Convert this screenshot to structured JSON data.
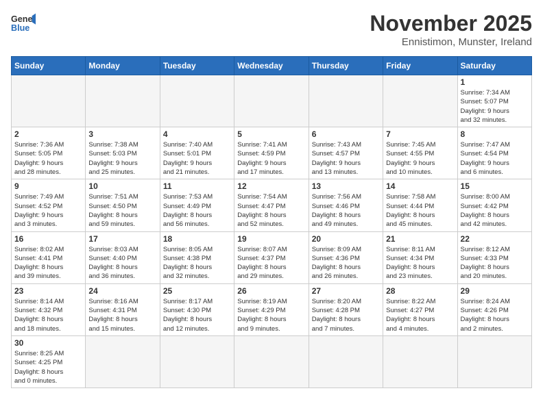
{
  "header": {
    "logo_general": "General",
    "logo_blue": "Blue",
    "month_title": "November 2025",
    "subtitle": "Ennistimon, Munster, Ireland"
  },
  "weekdays": [
    "Sunday",
    "Monday",
    "Tuesday",
    "Wednesday",
    "Thursday",
    "Friday",
    "Saturday"
  ],
  "weeks": [
    [
      {
        "day": null,
        "info": null
      },
      {
        "day": null,
        "info": null
      },
      {
        "day": null,
        "info": null
      },
      {
        "day": null,
        "info": null
      },
      {
        "day": null,
        "info": null
      },
      {
        "day": null,
        "info": null
      },
      {
        "day": "1",
        "info": "Sunrise: 7:34 AM\nSunset: 5:07 PM\nDaylight: 9 hours\nand 32 minutes."
      }
    ],
    [
      {
        "day": "2",
        "info": "Sunrise: 7:36 AM\nSunset: 5:05 PM\nDaylight: 9 hours\nand 28 minutes."
      },
      {
        "day": "3",
        "info": "Sunrise: 7:38 AM\nSunset: 5:03 PM\nDaylight: 9 hours\nand 25 minutes."
      },
      {
        "day": "4",
        "info": "Sunrise: 7:40 AM\nSunset: 5:01 PM\nDaylight: 9 hours\nand 21 minutes."
      },
      {
        "day": "5",
        "info": "Sunrise: 7:41 AM\nSunset: 4:59 PM\nDaylight: 9 hours\nand 17 minutes."
      },
      {
        "day": "6",
        "info": "Sunrise: 7:43 AM\nSunset: 4:57 PM\nDaylight: 9 hours\nand 13 minutes."
      },
      {
        "day": "7",
        "info": "Sunrise: 7:45 AM\nSunset: 4:55 PM\nDaylight: 9 hours\nand 10 minutes."
      },
      {
        "day": "8",
        "info": "Sunrise: 7:47 AM\nSunset: 4:54 PM\nDaylight: 9 hours\nand 6 minutes."
      }
    ],
    [
      {
        "day": "9",
        "info": "Sunrise: 7:49 AM\nSunset: 4:52 PM\nDaylight: 9 hours\nand 3 minutes."
      },
      {
        "day": "10",
        "info": "Sunrise: 7:51 AM\nSunset: 4:50 PM\nDaylight: 8 hours\nand 59 minutes."
      },
      {
        "day": "11",
        "info": "Sunrise: 7:53 AM\nSunset: 4:49 PM\nDaylight: 8 hours\nand 56 minutes."
      },
      {
        "day": "12",
        "info": "Sunrise: 7:54 AM\nSunset: 4:47 PM\nDaylight: 8 hours\nand 52 minutes."
      },
      {
        "day": "13",
        "info": "Sunrise: 7:56 AM\nSunset: 4:46 PM\nDaylight: 8 hours\nand 49 minutes."
      },
      {
        "day": "14",
        "info": "Sunrise: 7:58 AM\nSunset: 4:44 PM\nDaylight: 8 hours\nand 45 minutes."
      },
      {
        "day": "15",
        "info": "Sunrise: 8:00 AM\nSunset: 4:42 PM\nDaylight: 8 hours\nand 42 minutes."
      }
    ],
    [
      {
        "day": "16",
        "info": "Sunrise: 8:02 AM\nSunset: 4:41 PM\nDaylight: 8 hours\nand 39 minutes."
      },
      {
        "day": "17",
        "info": "Sunrise: 8:03 AM\nSunset: 4:40 PM\nDaylight: 8 hours\nand 36 minutes."
      },
      {
        "day": "18",
        "info": "Sunrise: 8:05 AM\nSunset: 4:38 PM\nDaylight: 8 hours\nand 32 minutes."
      },
      {
        "day": "19",
        "info": "Sunrise: 8:07 AM\nSunset: 4:37 PM\nDaylight: 8 hours\nand 29 minutes."
      },
      {
        "day": "20",
        "info": "Sunrise: 8:09 AM\nSunset: 4:36 PM\nDaylight: 8 hours\nand 26 minutes."
      },
      {
        "day": "21",
        "info": "Sunrise: 8:11 AM\nSunset: 4:34 PM\nDaylight: 8 hours\nand 23 minutes."
      },
      {
        "day": "22",
        "info": "Sunrise: 8:12 AM\nSunset: 4:33 PM\nDaylight: 8 hours\nand 20 minutes."
      }
    ],
    [
      {
        "day": "23",
        "info": "Sunrise: 8:14 AM\nSunset: 4:32 PM\nDaylight: 8 hours\nand 18 minutes."
      },
      {
        "day": "24",
        "info": "Sunrise: 8:16 AM\nSunset: 4:31 PM\nDaylight: 8 hours\nand 15 minutes."
      },
      {
        "day": "25",
        "info": "Sunrise: 8:17 AM\nSunset: 4:30 PM\nDaylight: 8 hours\nand 12 minutes."
      },
      {
        "day": "26",
        "info": "Sunrise: 8:19 AM\nSunset: 4:29 PM\nDaylight: 8 hours\nand 9 minutes."
      },
      {
        "day": "27",
        "info": "Sunrise: 8:20 AM\nSunset: 4:28 PM\nDaylight: 8 hours\nand 7 minutes."
      },
      {
        "day": "28",
        "info": "Sunrise: 8:22 AM\nSunset: 4:27 PM\nDaylight: 8 hours\nand 4 minutes."
      },
      {
        "day": "29",
        "info": "Sunrise: 8:24 AM\nSunset: 4:26 PM\nDaylight: 8 hours\nand 2 minutes."
      }
    ],
    [
      {
        "day": "30",
        "info": "Sunrise: 8:25 AM\nSunset: 4:25 PM\nDaylight: 8 hours\nand 0 minutes."
      },
      {
        "day": null,
        "info": null
      },
      {
        "day": null,
        "info": null
      },
      {
        "day": null,
        "info": null
      },
      {
        "day": null,
        "info": null
      },
      {
        "day": null,
        "info": null
      },
      {
        "day": null,
        "info": null
      }
    ]
  ]
}
